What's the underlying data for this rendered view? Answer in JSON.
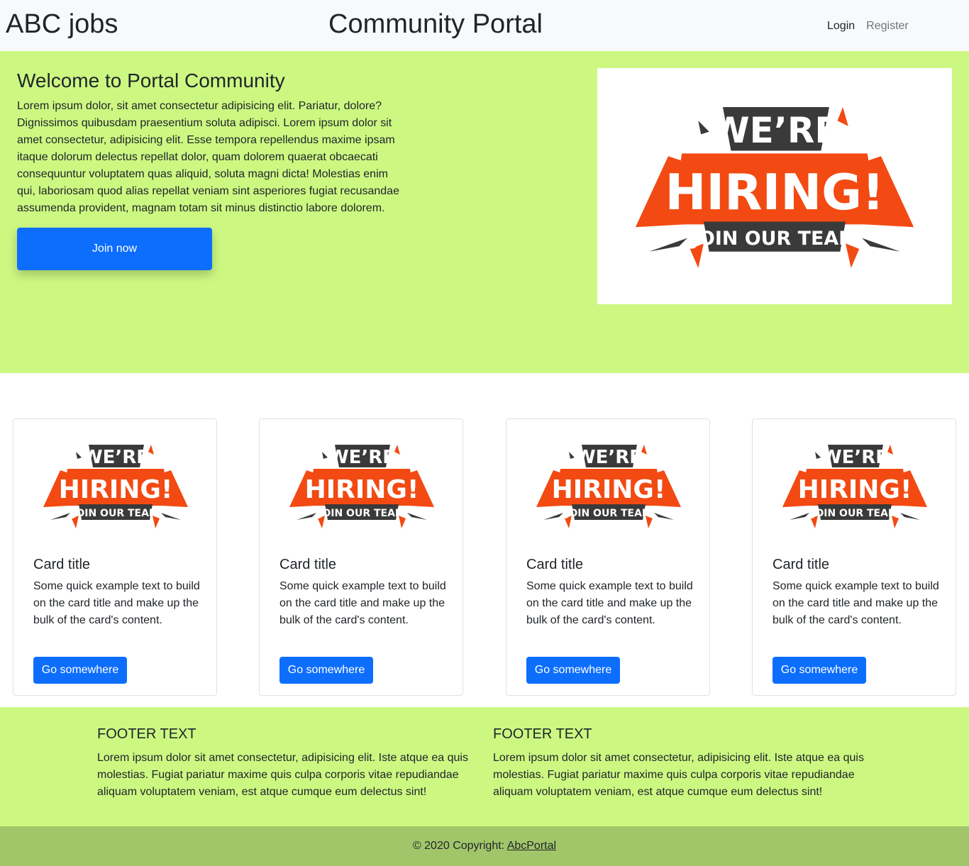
{
  "navbar": {
    "brand": "ABC jobs",
    "title": "Community Portal",
    "links": [
      "Login",
      "Register"
    ]
  },
  "hero": {
    "title": "Welcome to Portal Community",
    "text": "Lorem ipsum dolor, sit amet consectetur adipisicing elit. Pariatur, dolore? Dignissimos quibusdam praesentium soluta adipisci. Lorem ipsum dolor sit amet consectetur, adipisicing elit. Esse tempora repellendus maxime ipsam itaque dolorum delectus repellat dolor, quam dolorem quaerat obcaecati consequuntur voluptatem quas aliquid, soluta magni dicta! Molestias enim qui, laboriosam quod alias repellat veniam sint asperiores fugiat recusandae assumenda provident, magnam totam sit minus distinctio labore dolorem.",
    "button": "Join now",
    "image": {
      "line1": "WE’RE",
      "line2": "HIRING!",
      "line3": "JOIN OUR TEAM"
    }
  },
  "cards": [
    {
      "title": "Card title",
      "text": "Some quick example text to build on the card title and make up the bulk of the card's content.",
      "button": "Go somewhere"
    },
    {
      "title": "Card title",
      "text": "Some quick example text to build on the card title and make up the bulk of the card's content.",
      "button": "Go somewhere"
    },
    {
      "title": "Card title",
      "text": "Some quick example text to build on the card title and make up the bulk of the card's content.",
      "button": "Go somewhere"
    },
    {
      "title": "Card title",
      "text": "Some quick example text to build on the card title and make up the bulk of the card's content.",
      "button": "Go somewhere"
    }
  ],
  "footer": {
    "columns": [
      {
        "title": "FOOTER TEXT",
        "text": "Lorem ipsum dolor sit amet consectetur, adipisicing elit. Iste atque ea quis molestias. Fugiat pariatur maxime quis culpa corporis vitae repudiandae aliquam voluptatem veniam, est atque cumque eum delectus sint!"
      },
      {
        "title": "FOOTER TEXT",
        "text": "Lorem ipsum dolor sit amet consectetur, adipisicing elit. Iste atque ea quis molestias. Fugiat pariatur maxime quis culpa corporis vitae repudiandae aliquam voluptatem veniam, est atque cumque eum delectus sint!"
      }
    ],
    "copyright_prefix": "© 2020 Copyright: ",
    "copyright_link": "AbcPortal"
  },
  "colors": {
    "accent": "#0d6efd",
    "hero_bg": "#ccf882",
    "copyright_bg": "#a1c66a",
    "logo_orange": "#f24a12",
    "logo_dark": "#3a3a3a"
  }
}
